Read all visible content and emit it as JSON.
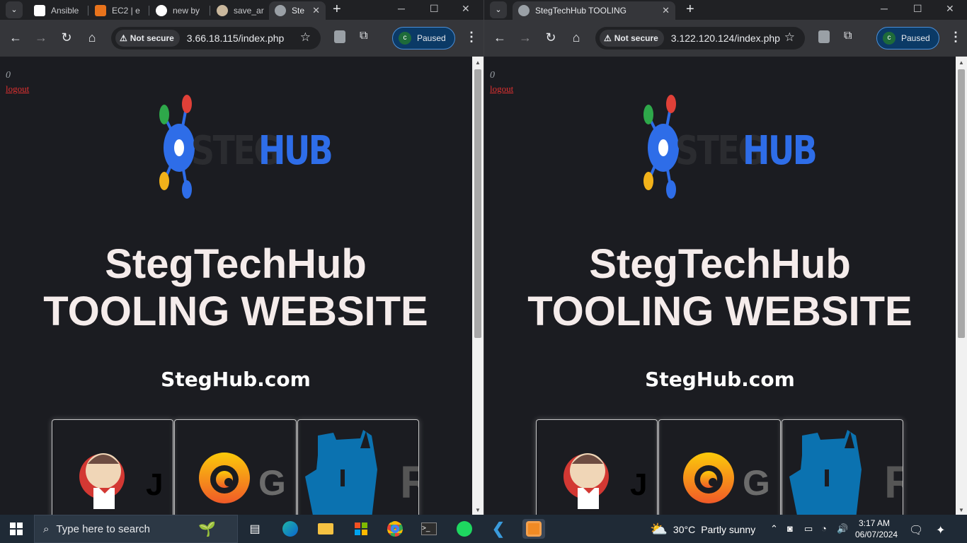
{
  "left_window": {
    "tabs": [
      {
        "label": "Ansible",
        "icon": "jira-icon"
      },
      {
        "label": "EC2 | e",
        "icon": "aws-icon"
      },
      {
        "label": "new by",
        "icon": "github-icon"
      },
      {
        "label": "save_ar",
        "icon": "avatar-icon"
      },
      {
        "label": "Ste",
        "icon": "globe-icon"
      }
    ],
    "address": {
      "security": "Not secure",
      "url": "3.66.18.115/index.php"
    },
    "profile": {
      "initial": "c",
      "label": "Paused"
    }
  },
  "right_window": {
    "tabs": [
      {
        "label": "StegTechHub TOOLING",
        "icon": "globe-icon"
      }
    ],
    "address": {
      "security": "Not secure",
      "url": "3.122.120.124/index.php"
    },
    "profile": {
      "initial": "c",
      "label": "Paused"
    }
  },
  "page": {
    "counter": "0",
    "logout": "logout",
    "logo_steg": "STEG",
    "logo_hub": "HUB",
    "title_line1": "StegTechHub",
    "title_line2": "TOOLING WEBSITE",
    "subtitle": "StegHub.com",
    "cards": [
      {
        "icon": "jenkins-icon",
        "text": "J"
      },
      {
        "icon": "grafana-icon",
        "text": "G"
      },
      {
        "icon": "phpmyadmin-elephant-icon",
        "text": "R"
      }
    ]
  },
  "taskbar": {
    "search_placeholder": "Type here to search",
    "weather": {
      "temp": "30°C",
      "desc": "Partly sunny"
    },
    "time": "3:17 AM",
    "date": "06/07/2024"
  }
}
